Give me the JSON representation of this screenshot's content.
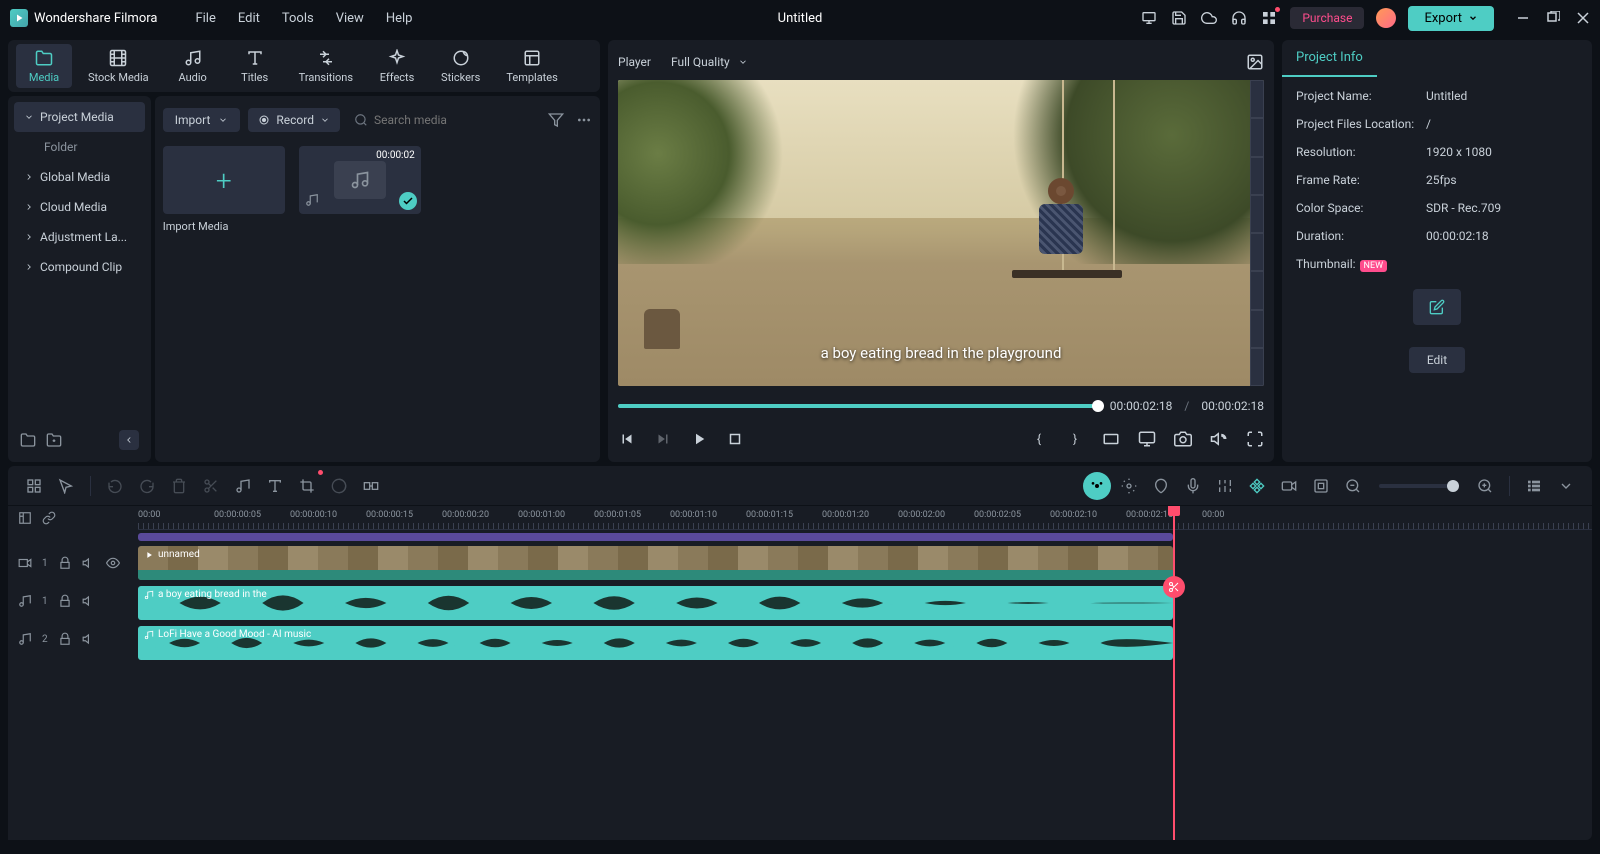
{
  "app": {
    "name": "Wondershare Filmora",
    "title": "Untitled"
  },
  "menu": [
    "File",
    "Edit",
    "Tools",
    "View",
    "Help"
  ],
  "titlebar": {
    "purchase": "Purchase",
    "export": "Export"
  },
  "tabs": [
    {
      "id": "media",
      "label": "Media"
    },
    {
      "id": "stock",
      "label": "Stock Media"
    },
    {
      "id": "audio",
      "label": "Audio"
    },
    {
      "id": "titles",
      "label": "Titles"
    },
    {
      "id": "transitions",
      "label": "Transitions"
    },
    {
      "id": "effects",
      "label": "Effects"
    },
    {
      "id": "stickers",
      "label": "Stickers"
    },
    {
      "id": "templates",
      "label": "Templates"
    }
  ],
  "sidebar": {
    "items": [
      "Project Media",
      "Folder",
      "Global Media",
      "Cloud Media",
      "Adjustment La...",
      "Compound Clip"
    ]
  },
  "media": {
    "import": "Import",
    "record": "Record",
    "search_placeholder": "Search media",
    "import_tile": "Import Media",
    "audio_tile_duration": "00:00:02"
  },
  "player": {
    "label": "Player",
    "quality": "Full Quality",
    "subtitle": "a boy eating bread in the playground",
    "current_time": "00:00:02:18",
    "total_time": "00:00:02:18"
  },
  "info": {
    "tab": "Project Info",
    "rows": {
      "name_label": "Project Name:",
      "name_value": "Untitled",
      "loc_label": "Project Files Location:",
      "loc_value": "/",
      "res_label": "Resolution:",
      "res_value": "1920 x 1080",
      "fps_label": "Frame Rate:",
      "fps_value": "25fps",
      "cs_label": "Color Space:",
      "cs_value": "SDR - Rec.709",
      "dur_label": "Duration:",
      "dur_value": "00:00:02:18",
      "thumb_label": "Thumbnail:"
    },
    "new_badge": "NEW",
    "edit": "Edit"
  },
  "ruler": [
    "00:00",
    "00:00:00:05",
    "00:00:00:10",
    "00:00:00:15",
    "00:00:00:20",
    "00:00:01:00",
    "00:00:01:05",
    "00:00:01:10",
    "00:00:01:15",
    "00:00:01:20",
    "00:00:02:00",
    "00:00:02:05",
    "00:00:02:10",
    "00:00:02:15",
    "00:00"
  ],
  "tracks": {
    "video": {
      "num": "1",
      "clip": "unnamed"
    },
    "audio1": {
      "num": "1",
      "clip": "a boy eating bread in the"
    },
    "audio2": {
      "num": "2",
      "clip": "LoFi Have a Good Mood - AI music"
    }
  }
}
